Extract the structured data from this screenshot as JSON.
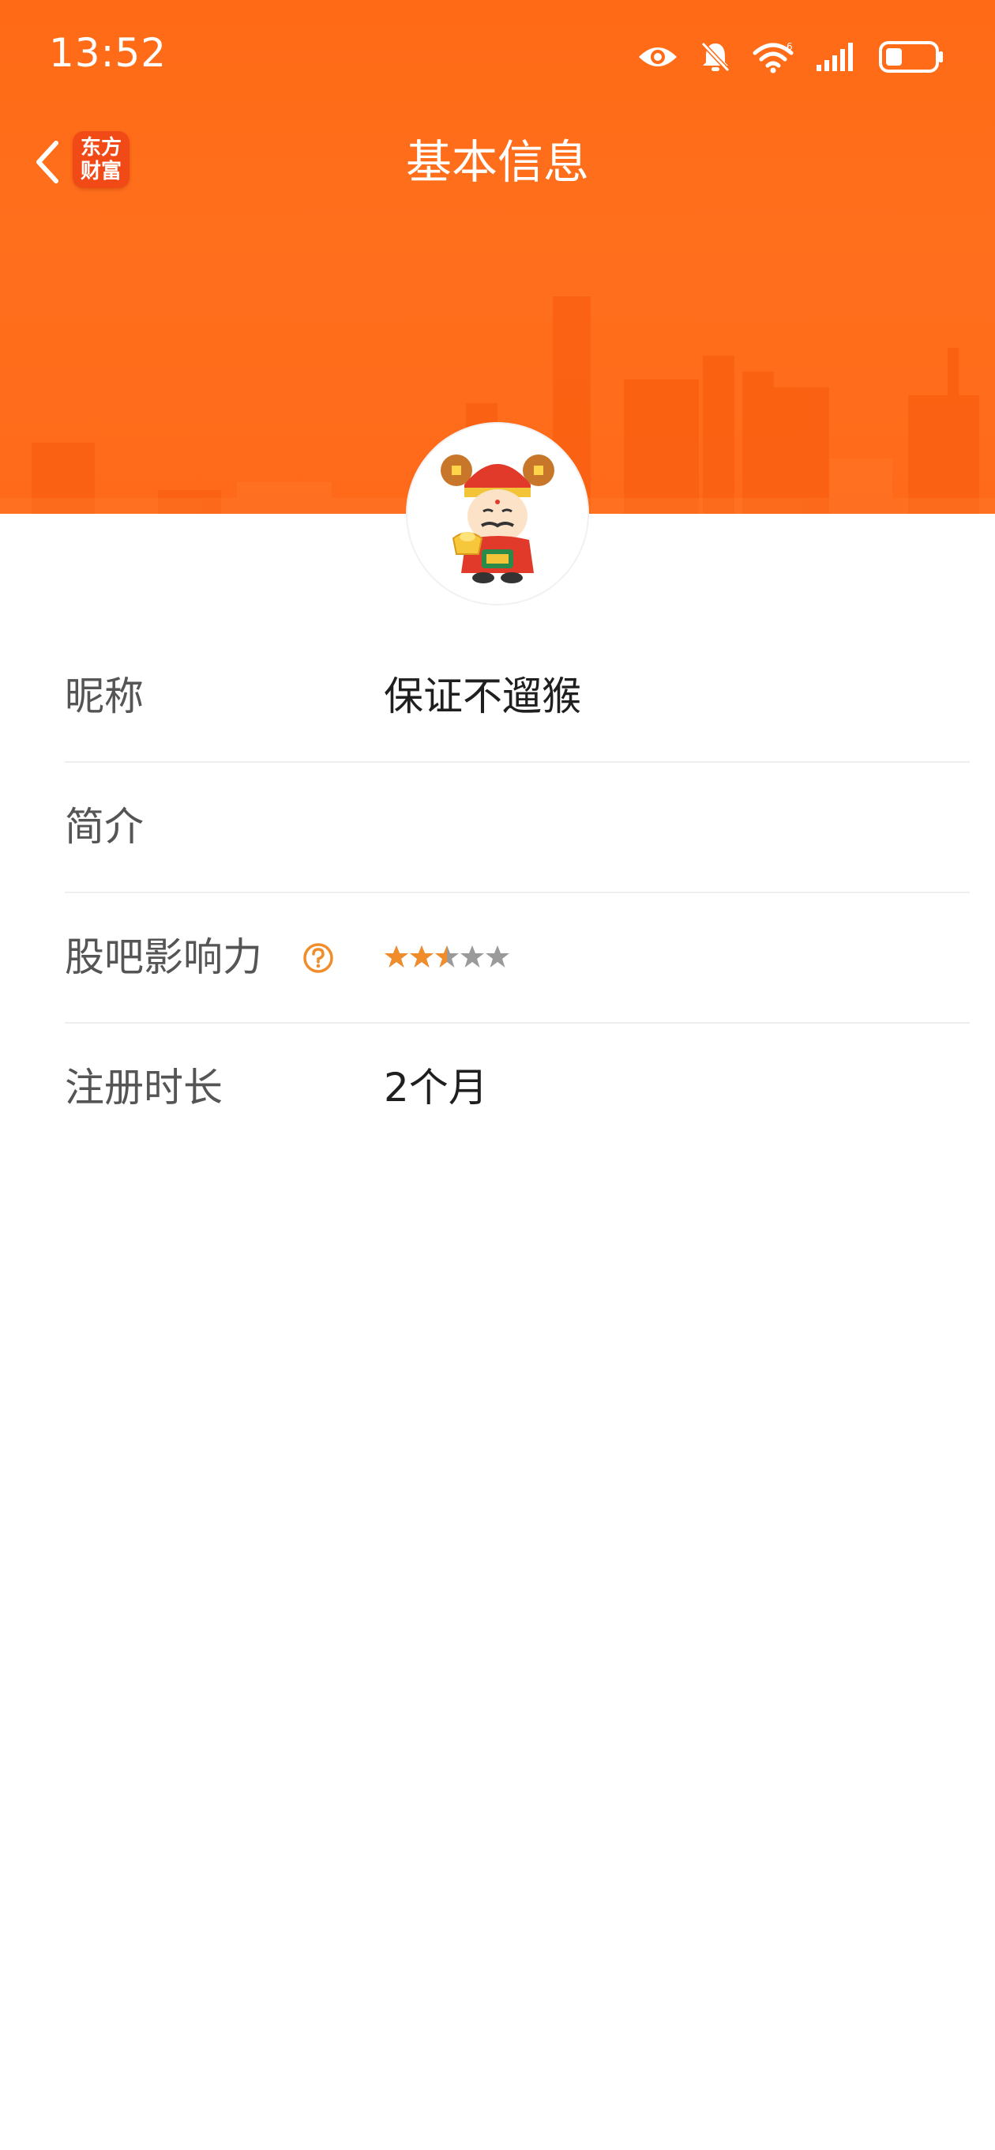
{
  "status_bar": {
    "time": "13:52",
    "icons": [
      "eye-icon",
      "bell-off-icon",
      "wifi-icon",
      "signal-icon",
      "battery-icon"
    ]
  },
  "nav": {
    "title": "基本信息",
    "app_logo_line1": "东方",
    "app_logo_line2": "财富"
  },
  "profile": {
    "avatar": "fortune-god-avatar",
    "rows": [
      {
        "label": "昵称",
        "value": "保证不遛猴"
      },
      {
        "label": "简介",
        "value": ""
      },
      {
        "label": "股吧影响力",
        "rating": 2.5,
        "rating_max": 5
      },
      {
        "label": "注册时长",
        "value": "2个月"
      }
    ]
  },
  "colors": {
    "header_orange": "#ff6a16",
    "star_active": "#f08c2a",
    "star_inactive": "#9a9a9a"
  }
}
